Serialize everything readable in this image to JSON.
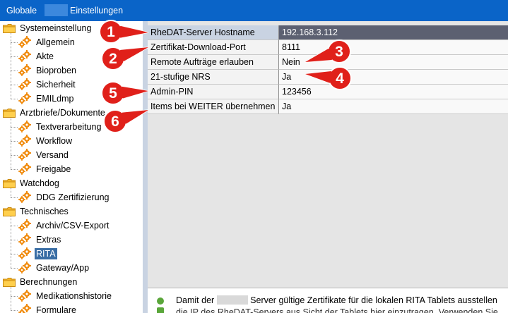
{
  "window": {
    "title_prefix": "Globale",
    "title_suffix": "Einstellungen"
  },
  "tree": {
    "groups": [
      {
        "label": "Systemeinstellung",
        "items": [
          "Allgemein",
          "Akte",
          "Bioproben",
          "Sicherheit",
          "EMILdmp"
        ]
      },
      {
        "label": "Arztbriefe/Dokumente",
        "items": [
          "Textverarbeitung",
          "Workflow",
          "Versand",
          "Freigabe"
        ]
      },
      {
        "label": "Watchdog",
        "items": [
          "DDG Zertifizierung"
        ]
      },
      {
        "label": "Technisches",
        "items": [
          "Archiv/CSV-Export",
          "Extras",
          "RITA",
          "Gateway/App"
        ]
      },
      {
        "label": "Berechnungen",
        "items": [
          "Medikationshistorie",
          "Formulare"
        ]
      }
    ],
    "selected": "RITA"
  },
  "grid": {
    "rows": [
      {
        "name": "RheDAT-Server Hostname",
        "value": "192.168.3.112"
      },
      {
        "name": "Zertifikat-Download-Port",
        "value": "8111"
      },
      {
        "name": "Remote Aufträge erlauben",
        "value": "Nein"
      },
      {
        "name": "21-stufige NRS",
        "value": "Ja"
      },
      {
        "name": "Admin-PIN",
        "value": "123456"
      },
      {
        "name": "Items bei WEITER übernehmen",
        "value": "Ja"
      }
    ]
  },
  "description": {
    "line1_prefix": "Damit der",
    "line1_suffix": "Server gültige Zertifikate für die lokalen RITA Tablets ausstellen",
    "line2": "die IP des RheDAT-Servers aus Sicht der Tablets hier einzutragen. Verwenden Sie"
  },
  "callouts": [
    "1",
    "2",
    "3",
    "4",
    "5",
    "6"
  ],
  "colors": {
    "titlebar": "#0a64c8",
    "selection": "#3a6ea5",
    "callout_red": "#e0201a"
  }
}
